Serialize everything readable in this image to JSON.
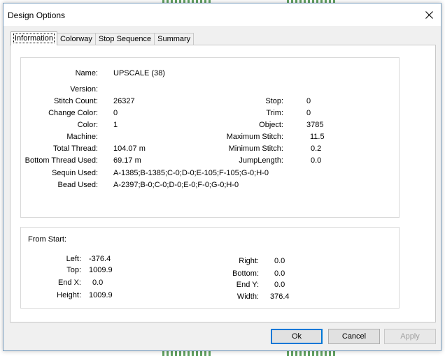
{
  "window": {
    "title": "Design Options"
  },
  "tabs": [
    {
      "label": "Information",
      "active": true
    },
    {
      "label": "Colorway",
      "active": false
    },
    {
      "label": "Stop Sequence",
      "active": false
    },
    {
      "label": "Summary",
      "active": false
    }
  ],
  "info": {
    "name_label": "Name:",
    "name_value": "UPSCALE (38)",
    "version_label": "Version:",
    "version_value": "",
    "stitch_count_label": "Stitch Count:",
    "stitch_count_value": "26327",
    "change_color_label": "Change Color:",
    "change_color_value": "0",
    "color_label": "Color:",
    "color_value": "1",
    "machine_label": "Machine:",
    "machine_value": "",
    "total_thread_label": "Total Thread:",
    "total_thread_value": "104.07 m",
    "bottom_thread_label": "Bottom Thread Used:",
    "bottom_thread_value": "69.17 m",
    "sequin_label": "Sequin Used:",
    "sequin_value": "A-1385;B-1385;C-0;D-0;E-105;F-105;G-0;H-0",
    "bead_label": "Bead Used:",
    "bead_value": "A-2397;B-0;C-0;D-0;E-0;F-0;G-0;H-0",
    "stop_label": "Stop:",
    "stop_value": "0",
    "trim_label": "Trim:",
    "trim_value": "0",
    "object_label": "Object:",
    "object_value": "3785",
    "max_stitch_label": "Maximum Stitch:",
    "max_stitch_value": "11.5",
    "min_stitch_label": "Minimum Stitch:",
    "min_stitch_value": "0.2",
    "jump_length_label": "JumpLength:",
    "jump_length_value": "0.0"
  },
  "from_start": {
    "heading": "From Start:",
    "left_label": "Left:",
    "left_value": "-376.4",
    "top_label": "Top:",
    "top_value": "1009.9",
    "end_x_label": "End X:",
    "end_x_value": "0.0",
    "height_label": "Height:",
    "height_value": "1009.9",
    "right_label": "Right:",
    "right_value": "0.0",
    "bottom_label": "Bottom:",
    "bottom_value": "0.0",
    "end_y_label": "End Y:",
    "end_y_value": "0.0",
    "width_label": "Width:",
    "width_value": "376.4"
  },
  "buttons": {
    "ok": "Ok",
    "cancel": "Cancel",
    "apply": "Apply"
  },
  "icons": {
    "close": "close-icon"
  },
  "colors": {
    "accent": "#0078d7",
    "dialog_bg": "#f0f0f0",
    "border": "#7a9ebf"
  }
}
